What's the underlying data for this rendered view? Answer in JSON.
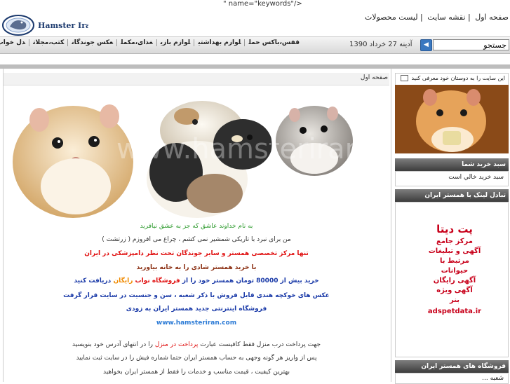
{
  "stray_text": "\" name=\"keywords\"/>",
  "logo": {
    "text": "Hamster Iran"
  },
  "top_links": [
    {
      "label": "صفحه اول"
    },
    {
      "label": "نقشه سایت"
    },
    {
      "label": "لیست محصولات"
    }
  ],
  "search": {
    "value": "جستجو"
  },
  "date": "آدینه 27 خرداد 1390",
  "menu": [
    {
      "label": "قفس،باکس حمل"
    },
    {
      "label": "لوازم بهداشتی"
    },
    {
      "label": "لوازم بازی"
    },
    {
      "label": "غذای،مکمل"
    },
    {
      "label": "عکس جوندگان"
    },
    {
      "label": "کتب،مجلات"
    },
    {
      "label": "دل خواب،قلاده"
    }
  ],
  "breadcrumb": "صفحه اول",
  "main": {
    "line1": "به نام خداوند عاشق که جز به عشق نیافرید",
    "line2": "من برای نبرد با تاریکی شمشیر نمی کشم ، چراغ می افروزم ( زرتشت )",
    "line3": "تنها مرکز تخصصی همستر و سایر جوندگان تحت نظر دامپزشکی در ایران",
    "line4": "با خرید همستر شادی را به خانه بیاورید",
    "line5a": "خرید بیش از 80000 تومان همستر خود را از",
    "line5b": "فروشگاه نواب",
    "line5c": "رایگان",
    "line5d": "دریافت کنید",
    "line6": "عکس های خوکچه هندی قابل فروش با ذکر شعبه ، سن و جنسیت در سایت قرار گرفت",
    "line7": "فروشگاه اینترنتی جدید همستر ایران به زودی",
    "site": "www.hamsteriran.com",
    "pay_a": "جهت پرداخت درب منزل فقط کافیست عبارت",
    "pay_b": "پرداخت در منزل",
    "pay_c": "را در انتهای آدرس خود بنویسید",
    "line9": "پس از واریز هر گونه وجهی به حساب همستر ایران حتما شماره فیش را در سایت ثبت نمایید",
    "line10": "بهترین کیفیت ، قیمت مناسب و خدمات را فقط از همستر ایران بخواهید"
  },
  "sidebar": {
    "invite": "این سایت را به دوستان خود معرفی کنید",
    "cart_head": "سبد خرید شما",
    "cart_text": "سبد خرید خالي است",
    "link_head": "تبادل لینک با همستر ایران",
    "ad_title": "پت دیتا",
    "ad_lines": [
      "مرکز جامع",
      "آگهی و تبلیغات",
      "مرتبط با",
      "حیوانات",
      "آگهی رایگان",
      "آگهی ویژه",
      "بنر"
    ],
    "ad_url": "adspetdata.ir",
    "shops_head": "فروشگاه های همستر ایران",
    "shops_item": "شعبه ..."
  },
  "colors": {
    "green": "#2e9b2e",
    "red": "#e01010",
    "blue": "#1a3aa8",
    "lightblue": "#2c7bd6",
    "orange": "#f08a00",
    "brown": "#8b2f12"
  }
}
